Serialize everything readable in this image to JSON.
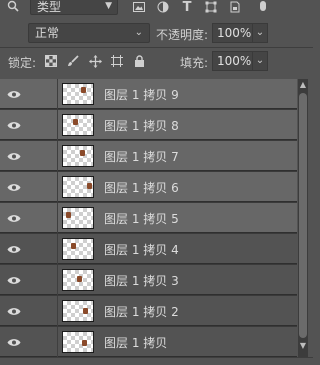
{
  "filter": {
    "kind_label": "类型",
    "icons": [
      "image-filter-icon",
      "adjustment-filter-icon",
      "type-filter-icon",
      "shape-filter-icon",
      "smart-object-filter-icon",
      "filter-toggle-icon"
    ]
  },
  "blend": {
    "mode": "正常",
    "opacity_label": "不透明度:",
    "opacity": "100%"
  },
  "lock": {
    "label": "锁定:",
    "icons": [
      "lock-transparent-pixels-icon",
      "lock-image-pixels-icon",
      "lock-position-icon",
      "lock-artboard-icon",
      "lock-all-icon"
    ],
    "fill_label": "填充:",
    "fill": "100%"
  },
  "layers": [
    {
      "name": "图层 1 拷贝 9",
      "selected": true
    },
    {
      "name": "图层 1 拷贝 8",
      "selected": true
    },
    {
      "name": "图层 1 拷贝 7",
      "selected": true
    },
    {
      "name": "图层 1 拷贝 6",
      "selected": true
    },
    {
      "name": "图层 1 拷贝 5",
      "selected": true
    },
    {
      "name": "图层 1 拷贝 4",
      "selected": false
    },
    {
      "name": "图层 1 拷贝 3",
      "selected": false
    },
    {
      "name": "图层 1 拷贝 2",
      "selected": false
    },
    {
      "name": "图层 1 拷贝",
      "selected": false
    }
  ],
  "colors": {
    "panel_bg": "#535353",
    "selected_row": "#676767",
    "thumb_mark": "#8a4a2a"
  }
}
